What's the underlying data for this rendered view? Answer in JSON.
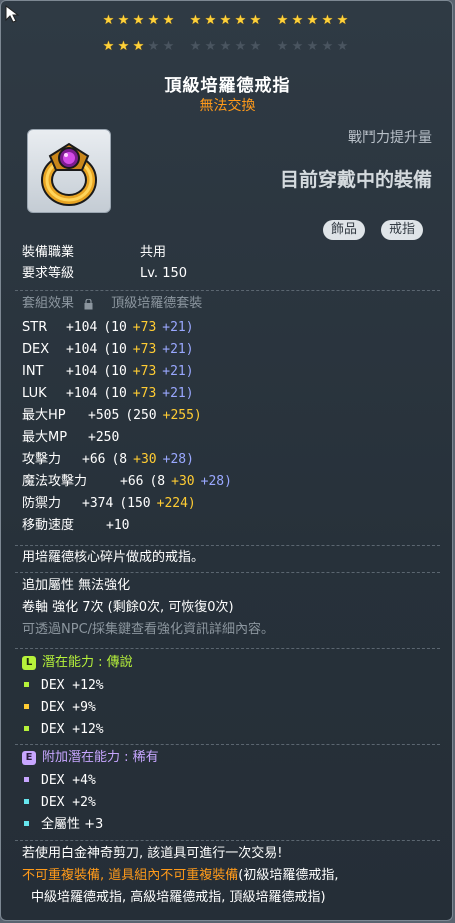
{
  "stars": {
    "row1": [
      5,
      5,
      5
    ],
    "row2_on": 3,
    "row2_groups": [
      5,
      5,
      5
    ]
  },
  "item": {
    "name": "頂級培羅德戒指",
    "trade_status": "無法交換",
    "power_label": "戰鬥力提升量",
    "equipped_label": "目前穿戴中的裝備",
    "tags": [
      "飾品",
      "戒指"
    ]
  },
  "requirements": {
    "job_label": "裝備職業",
    "job_value": "共用",
    "level_label": "要求等級",
    "level_value": "Lv. 150"
  },
  "set": {
    "label": "套組效果",
    "name": "頂級培羅德套裝"
  },
  "stats": [
    {
      "label": "STR",
      "total": "+104",
      "base": "(10",
      "scroll": "+73",
      "flame": "+21)"
    },
    {
      "label": "DEX",
      "total": "+104",
      "base": "(10",
      "scroll": "+73",
      "flame": "+21)"
    },
    {
      "label": "INT",
      "total": "+104",
      "base": "(10",
      "scroll": "+73",
      "flame": "+21)"
    },
    {
      "label": "LUK",
      "total": "+104",
      "base": "(10",
      "scroll": "+73",
      "flame": "+21)"
    },
    {
      "label": "最大HP",
      "total": "+505",
      "base": "(250",
      "scroll": "+255)",
      "flame": ""
    },
    {
      "label": "最大MP",
      "total": "+250",
      "base": "",
      "scroll": "",
      "flame": ""
    },
    {
      "label": "攻擊力",
      "total": "+66",
      "base": "(8",
      "scroll": "+30",
      "flame": "+28)"
    },
    {
      "label": "魔法攻擊力",
      "total": "+66",
      "base": "(8",
      "scroll": "+30",
      "flame": "+28)"
    },
    {
      "label": "防禦力",
      "total": "+374",
      "base": "(150",
      "scroll": "+224)",
      "flame": ""
    },
    {
      "label": "移動速度",
      "total": "+10",
      "base": "",
      "scroll": "",
      "flame": ""
    }
  ],
  "description": "用培羅德核心碎片做成的戒指。",
  "enhance": {
    "extra_option": "追加屬性 無法強化",
    "scroll_line": "卷軸 強化 7次 (剩餘0次, 可恢復0次)",
    "npc_hint": "可透過NPC/採集鍵查看強化資訊詳細內容。"
  },
  "potential": {
    "badge": "L",
    "title": "潛在能力 : 傳說",
    "color": "#b6f23a",
    "lines": [
      "DEX +12%",
      "DEX +9%",
      "DEX +12%"
    ]
  },
  "additional_potential": {
    "badge": "E",
    "title": "附加潛在能力 : 稀有",
    "color": "#c7a6ff",
    "lines": [
      "DEX +4%",
      "DEX +2%",
      "全屬性 +3"
    ]
  },
  "footer": {
    "line1": "若使用白金神奇剪刀, 該道具可進行一次交易!",
    "line2_orange": "不可重複裝備, 道具組內不可重複裝備",
    "line2_white": "(初級培羅德戒指,",
    "line3": "中級培羅德戒指, 高級培羅德戒指, 頂級培羅德戒指)"
  }
}
